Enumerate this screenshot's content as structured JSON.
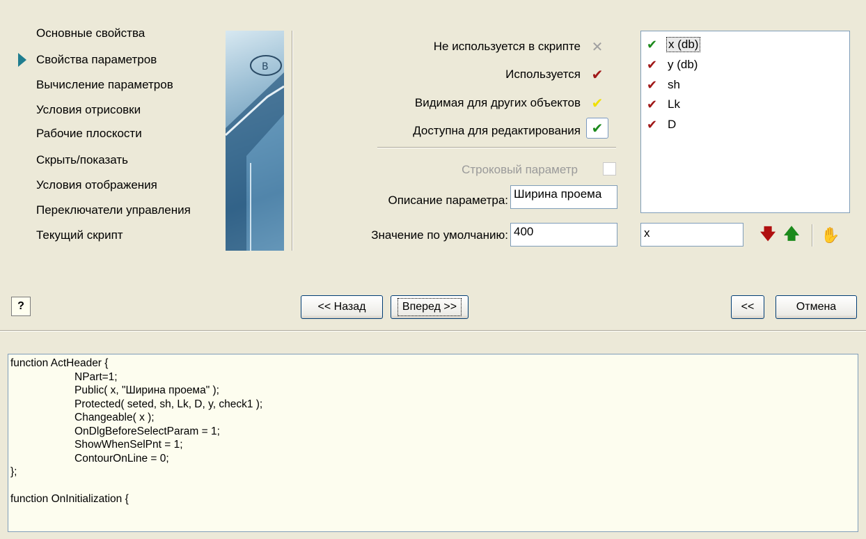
{
  "nav": {
    "items": [
      {
        "label": "Основные свойства",
        "active": false
      },
      {
        "label": "Свойства параметров",
        "active": true
      },
      {
        "label": "Вычисление параметров",
        "active": false
      },
      {
        "label": "Условия отрисовки",
        "active": false
      },
      {
        "label": "Рабочие плоскости",
        "active": false
      },
      {
        "label": "Скрыть/показать",
        "active": false
      },
      {
        "label": "Условия отображения",
        "active": false
      },
      {
        "label": "Переключатели управления",
        "active": false
      },
      {
        "label": "Текущий скрипт",
        "active": false
      }
    ]
  },
  "legend": {
    "not_used": {
      "label": "Не используется в скрипте",
      "icon": "gray-x-icon",
      "color": "#a0a0a0"
    },
    "used": {
      "label": "Используется",
      "icon": "red-check-icon",
      "color": "#a01818"
    },
    "visible": {
      "label": "Видимая для других объектов",
      "icon": "yellow-check-icon",
      "color": "#f0e000"
    },
    "editable": {
      "label": "Доступна для редактирования",
      "icon": "green-check-icon",
      "color": "#1c8a1c"
    }
  },
  "string_param": {
    "label": "Строковый параметр",
    "checked": false
  },
  "description": {
    "label": "Описание параметра:",
    "value": "Ширина проема"
  },
  "default_value": {
    "label": "Значение по умолчанию:",
    "value": "400"
  },
  "params": [
    {
      "name": "x (db)",
      "icon": "green-check-icon",
      "selected": true
    },
    {
      "name": "y (db)",
      "icon": "red-check-icon",
      "selected": false
    },
    {
      "name": "sh",
      "icon": "red-check-icon",
      "selected": false
    },
    {
      "name": "Lk",
      "icon": "red-check-icon",
      "selected": false
    },
    {
      "name": "D",
      "icon": "red-check-icon",
      "selected": false
    }
  ],
  "param_name_value": "x",
  "actions": {
    "move_down_icon": "red-down-arrow-icon",
    "move_up_icon": "green-up-arrow-icon",
    "edit_icon": "hand-icon"
  },
  "buttons": {
    "help": "?",
    "back": "<< Назад",
    "next": "Вперед >>",
    "collapse": "<<",
    "cancel": "Отмена"
  },
  "script": {
    "lines": [
      "function ActHeader {",
      "NPart=1;",
      "Public( x, \"Ширина проема\" );",
      "Protected( seted, sh, Lk, D, y, check1 );",
      "Changeable( x );",
      "OnDlgBeforeSelectParam = 1;",
      "ShowWhenSelPnt = 1;",
      "ContourOnLine = 0;",
      "};",
      "",
      "function OnInitialization {"
    ]
  }
}
